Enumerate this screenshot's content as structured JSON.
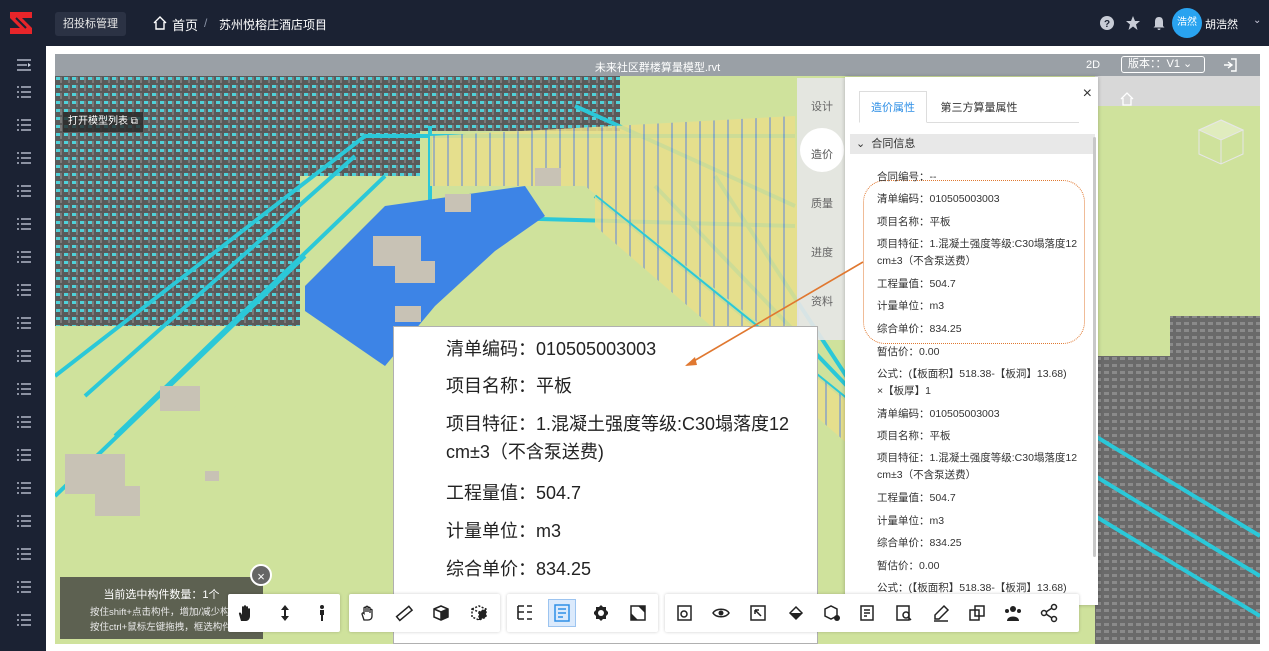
{
  "app": {
    "tooltip": "招投标管理",
    "home_label": "首页",
    "crumb_sep": "/",
    "project_name": "苏州悦榕庄酒店项目",
    "avatar_text": "浩然",
    "username": "胡浩然"
  },
  "viewer": {
    "file_title": "未来社区群楼算量模型.rvt",
    "mode": "2D",
    "version_label": "版本：：V1",
    "model_list_btn": "打开模型列表",
    "vtabs": [
      "设计",
      "造价",
      "质量",
      "进度",
      "资料"
    ]
  },
  "callout": {
    "rows": [
      "清单编码：010505003003",
      "项目名称：平板",
      "项目特征：1.混凝土强度等级:C30塌落度12",
      "cm±3（不含泵送费)",
      "工程量值：504.7",
      "计量单位：m3",
      "综合单价：834.25"
    ]
  },
  "panel": {
    "close": "×",
    "tabs": [
      "造价属性",
      "第三方算量属性"
    ],
    "section": "合同信息",
    "props": [
      "合同编号：--",
      "清单编码：010505003003",
      "项目名称：平板",
      "项目特征：1.混凝土强度等级:C30塌落度12",
      "cm±3（不含泵送费）",
      "工程量值：504.7",
      "计量单位：m3",
      "综合单价：834.25",
      "暂估价：0.00",
      "公式：(【板面积】518.38-【板洞】13.68)",
      "×【板厚】1",
      "清单编码：010505003003",
      "项目名称：平板",
      "项目特征：1.混凝土强度等级:C30塌落度12",
      "cm±3（不含泵送费）",
      "工程量值：504.7",
      "计量单位：m3",
      "综合单价：834.25",
      "暂估价：0.00",
      "公式：(【板面积】518.38-【板洞】13.68)"
    ]
  },
  "selection": {
    "count": "当前选中构件数量：1个",
    "tip1": "按住shift+点击构件，增加/减少构件",
    "tip2": "按住ctrl+鼠标左键拖拽，框选构件",
    "close": "×"
  },
  "toolbar": {
    "groups": [
      [
        "pan-hand-icon",
        "up-down-arrow-icon",
        "walk-person-icon"
      ],
      [
        "rotate-hand-icon",
        "ruler-icon",
        "cube-dropdown-icon",
        "section-box-icon"
      ],
      [
        "tree-structure-icon",
        "properties-list-icon",
        "settings-gear-icon",
        "fullscreen-icon"
      ],
      [
        "filter-icon",
        "visibility-icon",
        "select-box-icon",
        "paint-bucket-icon",
        "model-info-icon",
        "report-icon",
        "document-search-icon",
        "edit-note-icon",
        "compare-icon",
        "people-icon",
        "share-icon"
      ]
    ]
  },
  "colors": {
    "topbar": "#1b2233",
    "accent": "#2e8fe6",
    "ground": "#c9dca0",
    "water": "#3d84e6",
    "ring": "#e07830"
  }
}
